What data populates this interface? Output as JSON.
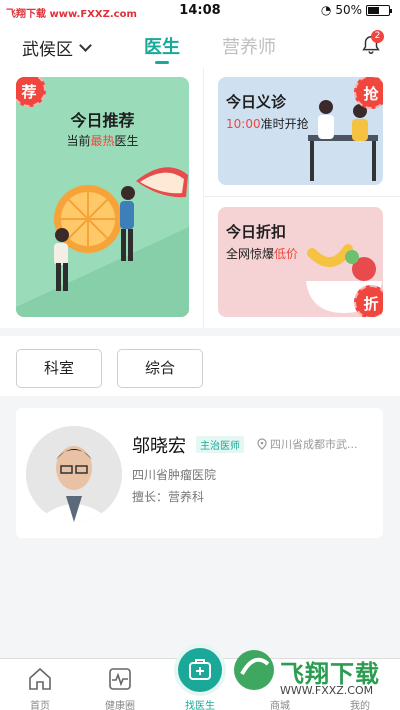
{
  "status_bar": {
    "carrier": "飞翔下载 www.FXXZ.com",
    "time": "14:08",
    "battery": "50%"
  },
  "header": {
    "location": "武侯区",
    "tabs": [
      {
        "label": "医生",
        "active": true
      },
      {
        "label": "营养师",
        "active": false
      }
    ],
    "notification_count": "2"
  },
  "banners": {
    "recommend": {
      "stamp": "荐",
      "title": "今日推荐",
      "sub_prefix": "当前",
      "sub_hot": "最热",
      "sub_suffix": "医生"
    },
    "free_clinic": {
      "stamp": "抢",
      "title": "今日义诊",
      "sub_time": "10:00",
      "sub_suffix": "准时开抢"
    },
    "discount": {
      "stamp": "折",
      "title": "今日折扣",
      "sub_prefix": "全网惊爆",
      "sub_low": "低价"
    }
  },
  "filters": [
    {
      "label": "科室"
    },
    {
      "label": "综合"
    }
  ],
  "doctor": {
    "name": "邬晓宏",
    "title": "主治医师",
    "location": "四川省成都市武...",
    "hospital": "四川省肿瘤医院",
    "specialty": "擅长：营养科"
  },
  "tabbar": [
    {
      "label": "首页"
    },
    {
      "label": "健康圈"
    },
    {
      "label": "找医生",
      "active": true
    },
    {
      "label": "商城"
    },
    {
      "label": "我的"
    }
  ],
  "watermark": {
    "text": "飞翔下载",
    "url": "WWW.FXXZ.COM"
  },
  "colors": {
    "accent": "#1aa998",
    "red": "#f0463e",
    "green_card": "#9adcb9",
    "blue_card": "#cfe0f0",
    "pink_card": "#f5d3d4"
  }
}
